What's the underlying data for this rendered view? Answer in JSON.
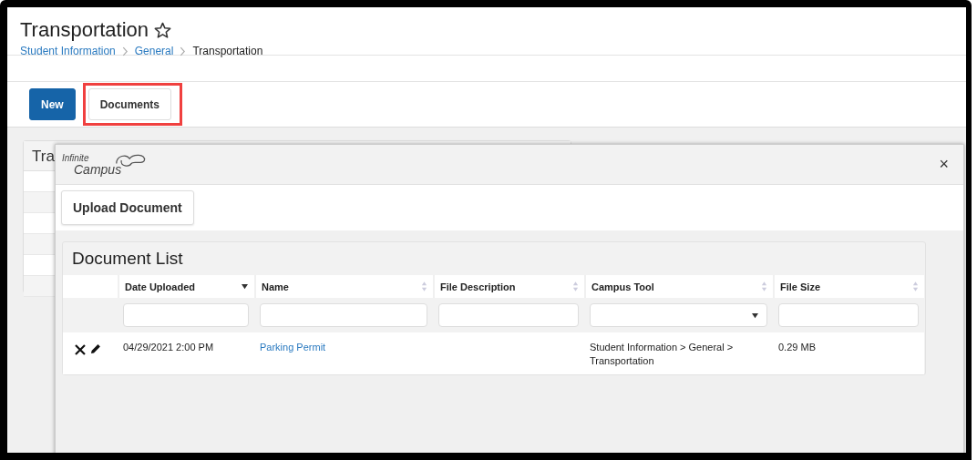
{
  "page": {
    "title": "Transportation",
    "favorite": false,
    "breadcrumb": [
      {
        "label": "Student Information",
        "link": true
      },
      {
        "label": "General",
        "link": true
      },
      {
        "label": "Transportation",
        "link": false
      }
    ]
  },
  "toolbar": [
    {
      "label": "New",
      "kind": "primary",
      "highlighted": false
    },
    {
      "label": "Documents",
      "kind": "secondary",
      "highlighted": true
    }
  ],
  "background_panel": {
    "title": "Tra"
  },
  "dialog": {
    "logo": {
      "line_1": "Infinite",
      "line_2": "Campus"
    },
    "close": "×",
    "upload_button": "Upload Document",
    "list_title": "Document List",
    "columns": [
      {
        "label": "Date Uploaded",
        "sorted": true,
        "filter_dropdown": false
      },
      {
        "label": "Name",
        "sorted": false,
        "filter_dropdown": false
      },
      {
        "label": "File Description",
        "sorted": false,
        "filter_dropdown": false
      },
      {
        "label": "Campus Tool",
        "sorted": false,
        "filter_dropdown": true
      },
      {
        "label": "File Size",
        "sorted": false,
        "filter_dropdown": false
      }
    ],
    "rows": [
      {
        "cells": [
          {
            "kind": "text",
            "text": "04/29/2021 2:00 PM"
          },
          {
            "kind": "link",
            "text": "Parking Permit"
          },
          {
            "kind": "blank"
          },
          {
            "kind": "text",
            "text": "Student Information > General > Transportation"
          },
          {
            "kind": "text",
            "text": "0.29 MB"
          }
        ]
      }
    ]
  }
}
